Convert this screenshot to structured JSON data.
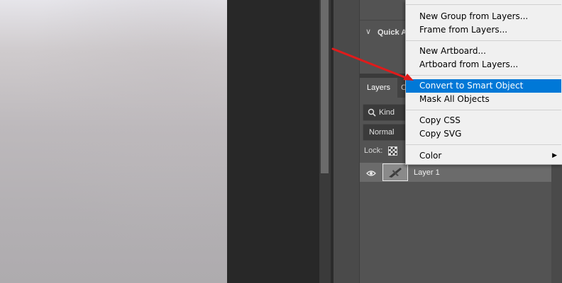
{
  "properties_panel": {
    "quick_actions_label": "Quick A"
  },
  "layers_panel": {
    "tabs": [
      {
        "label": "Layers",
        "active": true
      },
      {
        "label": "C",
        "active": false
      }
    ],
    "filter": {
      "value": "Kind",
      "icon": "search-icon"
    },
    "blend_mode": {
      "value": "Normal"
    },
    "lock_label": "Lock:",
    "layers": [
      {
        "name": "Layer 1",
        "visible": true,
        "selected": true
      }
    ]
  },
  "context_menu": {
    "items": [
      {
        "label": "New Group from Layers...",
        "highlighted": false
      },
      {
        "label": "Frame from Layers...",
        "highlighted": false
      },
      {
        "label": "New Artboard...",
        "highlighted": false
      },
      {
        "label": "Artboard from Layers...",
        "highlighted": false
      },
      {
        "label": "Convert to Smart Object",
        "highlighted": true
      },
      {
        "label": "Mask All Objects",
        "highlighted": false
      },
      {
        "label": "Copy CSS",
        "highlighted": false
      },
      {
        "label": "Copy SVG",
        "highlighted": false
      },
      {
        "label": "Color",
        "highlighted": false,
        "has_submenu": true
      }
    ]
  },
  "colors": {
    "menu_highlight": "#0078d7",
    "annotation_arrow": "#e01b1b",
    "panel_bg": "#535353"
  }
}
